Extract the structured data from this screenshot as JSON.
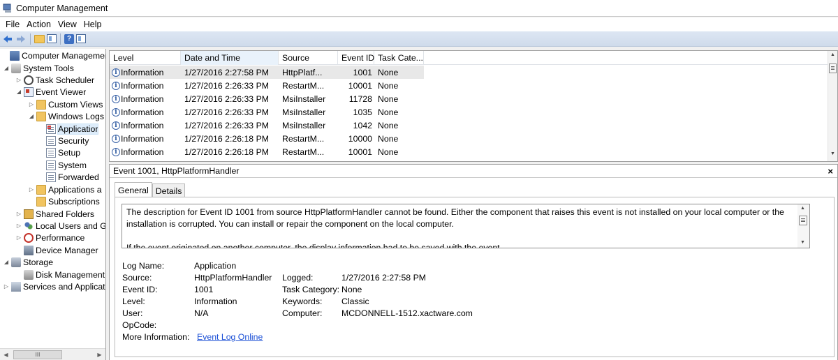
{
  "window": {
    "title": "Computer Management"
  },
  "menu": [
    "File",
    "Action",
    "View",
    "Help"
  ],
  "toolbar": {
    "icons": [
      "back-arrow-icon",
      "forward-arrow-icon",
      "up-folder-icon",
      "show-hide-tree-icon",
      "help-icon",
      "properties-icon"
    ]
  },
  "tree": {
    "items": [
      {
        "label": "Computer Management",
        "icon": "computer-management-icon",
        "expander": ""
      },
      {
        "label": "System Tools",
        "icon": "system-tools-icon",
        "expander": "◢"
      },
      {
        "label": "Task Scheduler",
        "icon": "task-scheduler-icon",
        "expander": "▷"
      },
      {
        "label": "Event Viewer",
        "icon": "event-viewer-icon",
        "expander": "◢"
      },
      {
        "label": "Custom Views",
        "icon": "folder-icon",
        "expander": "▷"
      },
      {
        "label": "Windows Logs",
        "icon": "folder-icon",
        "expander": "◢"
      },
      {
        "label": "Applicatior",
        "icon": "application-log-icon",
        "expander": ""
      },
      {
        "label": "Security",
        "icon": "log-icon",
        "expander": ""
      },
      {
        "label": "Setup",
        "icon": "log-icon",
        "expander": ""
      },
      {
        "label": "System",
        "icon": "log-icon",
        "expander": ""
      },
      {
        "label": "Forwarded",
        "icon": "log-icon",
        "expander": ""
      },
      {
        "label": "Applications a",
        "icon": "folder-icon",
        "expander": "▷"
      },
      {
        "label": "Subscriptions",
        "icon": "subscriptions-icon",
        "expander": ""
      },
      {
        "label": "Shared Folders",
        "icon": "shared-folders-icon",
        "expander": "▷"
      },
      {
        "label": "Local Users and G",
        "icon": "local-users-icon",
        "expander": "▷"
      },
      {
        "label": "Performance",
        "icon": "performance-icon",
        "expander": "▷"
      },
      {
        "label": "Device Manager",
        "icon": "device-manager-icon",
        "expander": ""
      },
      {
        "label": "Storage",
        "icon": "storage-icon",
        "expander": "◢"
      },
      {
        "label": "Disk Management",
        "icon": "disk-management-icon",
        "expander": ""
      },
      {
        "label": "Services and Applicat",
        "icon": "services-icon",
        "expander": "▷"
      }
    ],
    "scroll_thumb": "III"
  },
  "events": {
    "columns": [
      "Level",
      "Date and Time",
      "Source",
      "Event ID",
      "Task Cate..."
    ],
    "rows": [
      {
        "level": "Information",
        "datetime": "1/27/2016 2:27:58 PM",
        "source": "HttpPlatf...",
        "event_id": "1001",
        "task": "None"
      },
      {
        "level": "Information",
        "datetime": "1/27/2016 2:26:33 PM",
        "source": "RestartM...",
        "event_id": "10001",
        "task": "None"
      },
      {
        "level": "Information",
        "datetime": "1/27/2016 2:26:33 PM",
        "source": "MsiInstaller",
        "event_id": "11728",
        "task": "None"
      },
      {
        "level": "Information",
        "datetime": "1/27/2016 2:26:33 PM",
        "source": "MsiInstaller",
        "event_id": "1035",
        "task": "None"
      },
      {
        "level": "Information",
        "datetime": "1/27/2016 2:26:33 PM",
        "source": "MsiInstaller",
        "event_id": "1042",
        "task": "None"
      },
      {
        "level": "Information",
        "datetime": "1/27/2016 2:26:18 PM",
        "source": "RestartM...",
        "event_id": "10000",
        "task": "None"
      },
      {
        "level": "Information",
        "datetime": "1/27/2016 2:26:18 PM",
        "source": "RestartM...",
        "event_id": "10001",
        "task": "None"
      }
    ]
  },
  "detail": {
    "header": "Event 1001, HttpPlatformHandler",
    "close": "×",
    "tabs": [
      "General",
      "Details"
    ],
    "description_line1": "The description for Event ID 1001 from source HttpPlatformHandler cannot be found. Either the component that raises this event is not installed on your local computer or the installation is corrupted. You can install or repair the component on the local computer.",
    "description_line2": "If the event originated on another computer, the display information had to be saved with the event.",
    "labels": {
      "log_name": "Log Name:",
      "source": "Source:",
      "event_id": "Event ID:",
      "level": "Level:",
      "user": "User:",
      "opcode": "OpCode:",
      "more_info": "More Information:",
      "logged": "Logged:",
      "task_category": "Task Category:",
      "keywords": "Keywords:",
      "computer": "Computer:"
    },
    "values": {
      "log_name": "Application",
      "source": "HttpPlatformHandler",
      "event_id": "1001",
      "level": "Information",
      "user": "N/A",
      "opcode": "",
      "more_info_link": "Event Log Online",
      "logged": "1/27/2016 2:27:58 PM",
      "task_category": "None",
      "keywords": "Classic",
      "computer": "MCDONNELL-1512.xactware.com"
    }
  }
}
